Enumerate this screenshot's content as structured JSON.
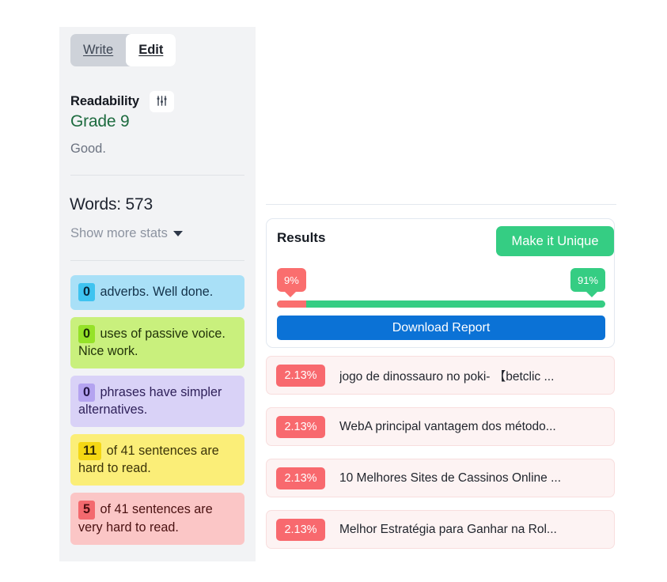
{
  "sidebar": {
    "tabs": [
      {
        "label": "Write",
        "active": false
      },
      {
        "label": "Edit",
        "active": true
      }
    ],
    "readability": {
      "title": "Readability",
      "settings_icon": "sliders-icon",
      "grade": "Grade 9",
      "note": "Good.",
      "grade_color": "#1d6b3f"
    },
    "word_count": "Words: 573",
    "show_more_stats": "Show more stats",
    "stats": [
      {
        "count": "0",
        "text": "adverbs. Well done.",
        "theme": "s-blue",
        "bg": "#a9e0f7",
        "badge_bg": "#3ec3f0"
      },
      {
        "count": "0",
        "text": "uses of passive voice. Nice work.",
        "theme": "s-green",
        "bg": "#c9f07d",
        "badge_bg": "#95e228"
      },
      {
        "count": "0",
        "text": "phrases have simpler alternatives.",
        "theme": "s-purple",
        "bg": "#d9d2f7",
        "badge_bg": "#b4a3f0"
      },
      {
        "count": "11",
        "text": "of 41 sentences are hard to read.",
        "theme": "s-yellow",
        "bg": "#fbee78",
        "badge_bg": "#f4d713"
      },
      {
        "count": "5",
        "text": "of 41 sentences are very hard to read.",
        "theme": "s-red",
        "bg": "#fbc6c6",
        "badge_bg": "#f3696e"
      }
    ]
  },
  "results": {
    "title": "Results",
    "make_unique_label": "Make it Unique",
    "make_unique_color": "#35cd83",
    "download_label": "Download Report",
    "download_color": "#0b72d6",
    "meter": {
      "plagiarized_pct": "9%",
      "unique_pct": "91%",
      "plagiarized_value": 9,
      "unique_value": 91,
      "plagiarized_color": "#fa6e6e",
      "unique_color": "#35cd83"
    }
  },
  "matches": [
    {
      "pct": "2.13%",
      "title": "jogo de dinossauro no poki- 【betclic ..."
    },
    {
      "pct": "2.13%",
      "title": "WebA principal vantagem dos método..."
    },
    {
      "pct": "2.13%",
      "title": "10 Melhores Sites de Cassinos Online ..."
    },
    {
      "pct": "2.13%",
      "title": "Melhor Estratégia para Ganhar na Rol..."
    }
  ]
}
